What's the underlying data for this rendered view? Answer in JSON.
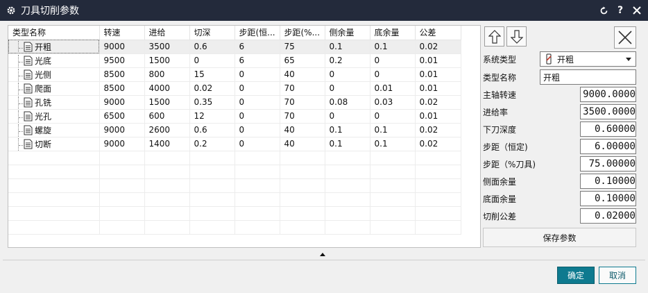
{
  "window": {
    "title": "刀具切削参数"
  },
  "table": {
    "columns": [
      "类型名称",
      "转速",
      "进给",
      "切深",
      "步距(恒...",
      "步距(%...",
      "侧余量",
      "底余量",
      "公差"
    ],
    "rows": [
      [
        "开粗",
        "9000",
        "3500",
        "0.6",
        "6",
        "75",
        "0.1",
        "0.1",
        "0.02"
      ],
      [
        "光底",
        "9500",
        "1500",
        "0",
        "6",
        "65",
        "0.2",
        "0",
        "0.01"
      ],
      [
        "光侧",
        "8500",
        "800",
        "15",
        "0",
        "40",
        "0",
        "0",
        "0.01"
      ],
      [
        "爬面",
        "8500",
        "4000",
        "0.02",
        "0",
        "70",
        "0",
        "0.01",
        "0.01"
      ],
      [
        "孔铣",
        "9000",
        "1500",
        "0.35",
        "0",
        "70",
        "0.08",
        "0.03",
        "0.02"
      ],
      [
        "光孔",
        "6500",
        "600",
        "12",
        "0",
        "70",
        "0",
        "0",
        "0.01"
      ],
      [
        "螺旋",
        "9000",
        "2600",
        "0.6",
        "0",
        "40",
        "0.1",
        "0.1",
        "0.02"
      ],
      [
        "切断",
        "9000",
        "1400",
        "0.2",
        "0",
        "40",
        "0.1",
        "0.1",
        "0.02"
      ]
    ],
    "selected_row": 0,
    "empty_rows": 6
  },
  "panel": {
    "fields": {
      "system_type": {
        "label": "系统类型",
        "value": "开粗"
      },
      "type_name": {
        "label": "类型名称",
        "value": "开粗"
      },
      "spindle_speed": {
        "label": "主轴转速",
        "value": "9000.0000"
      },
      "feed_rate": {
        "label": "进给率",
        "value": "3500.0000"
      },
      "depth": {
        "label": "下刀深度",
        "value": "0.60000"
      },
      "step_const": {
        "label": "步距（恒定)",
        "value": "6.00000"
      },
      "step_pct": {
        "label": "步距（%刀具)",
        "value": "75.00000"
      },
      "side_stock": {
        "label": "侧面余量",
        "value": "0.10000"
      },
      "floor_stock": {
        "label": "底面余量",
        "value": "0.10000"
      },
      "tolerance": {
        "label": "切削公差",
        "value": "0.02000"
      }
    },
    "save_label": "保存参数"
  },
  "footer": {
    "ok_label": "确定",
    "cancel_label": "取消"
  },
  "colors": {
    "titlebar": "#232a3b",
    "accent": "#0e7a8f"
  },
  "icons": [
    "gear-icon",
    "reset-icon",
    "help-icon",
    "close-icon",
    "arrow-up-icon",
    "arrow-down-icon",
    "document-icon",
    "tool-type-icon"
  ]
}
